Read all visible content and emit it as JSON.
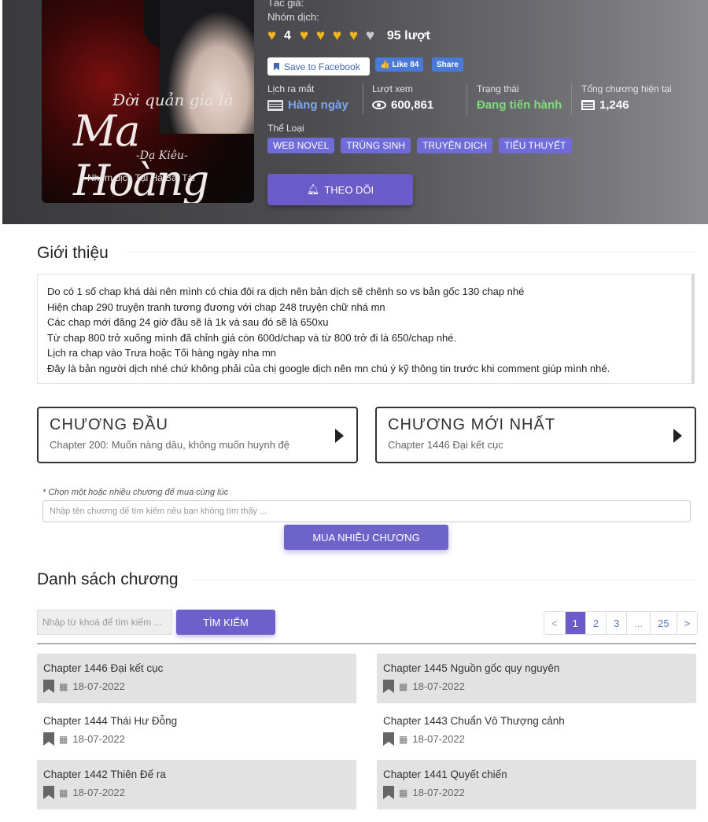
{
  "cover": {
    "title_line1": "Đời quản gia là",
    "title_main": "Ma Hoàng",
    "author_mark": "-Dạ Kiêu-",
    "group": "Nhóm dịch Tại Hạ Bất Tài"
  },
  "info": {
    "author_label": "Tác giả:",
    "translator_label": "Nhóm dịch:",
    "rating_value": "4",
    "rating_count": "95 lượt",
    "fb_save": "Save to Facebook",
    "fb_like": "Like 84",
    "fb_share": "Share"
  },
  "stats": [
    {
      "label": "Lịch ra mắt",
      "value": "Hàng ngày",
      "icon": "newspaper-icon"
    },
    {
      "label": "Lượt xem",
      "value": "600,861",
      "icon": "eye-icon"
    },
    {
      "label": "Trạng thái",
      "value": "Đang tiến hành",
      "icon": ""
    },
    {
      "label": "Tổng chương hiện tại",
      "value": "1,246",
      "icon": "list-icon"
    }
  ],
  "genre_label": "Thể Loại",
  "tags": [
    "WEB NOVEL",
    "TRÙNG SINH",
    "TRUYỆN DỊCH",
    "TIỂU THUYẾT"
  ],
  "follow_label": "THEO DÕI",
  "intro": {
    "title": "Giới thiệu",
    "lines": [
      "Do có 1 số chap khá dài nên mình có chia đôi ra dịch nên bản dịch sẽ chênh so vs bản gốc 130 chap nhé",
      "Hiện chap 290 truyện tranh tương đương với chap 248 truyện chữ nhá mn",
      "Các chap mới đăng 24 giờ đầu sẽ là 1k và sau đó sẽ là 650xu",
      "Từ  chap 800 trở xuống mình đã chỉnh giá còn 600d/chap và từ 800 trở đi là 650/chap nhé.",
      "Lịch ra chap vào Trưa hoặc Tối hàng ngày nha mn",
      "Đây là bản người dịch nhé chứ không phải của chị google dịch nên mn chú ý kỹ thông tin trước khi comment giúp mình nhé."
    ]
  },
  "first_chapter": {
    "heading": "CHƯƠNG ĐẦU",
    "sub": "Chapter 200: Muốn nàng dâu, không muốn huynh đệ"
  },
  "latest_chapter": {
    "heading": "CHƯƠNG MỚI NHẤT",
    "sub": "Chapter 1446 Đại kết cục"
  },
  "multi": {
    "hint": "* Chọn một hoặc nhiều chương để mua cùng lúc",
    "placeholder": "Nhập tên chương để tìm kiếm nếu bạn không tìm thấy ...",
    "button": "MUA NHIỀU CHƯƠNG"
  },
  "chapter_list": {
    "title": "Danh sách chương",
    "search_placeholder": "Nhập từ khoá để tìm kiếm ...",
    "search_button": "TÌM KIẾM",
    "pages": [
      "<",
      "1",
      "2",
      "3",
      "...",
      "25",
      ">"
    ],
    "items": [
      {
        "name": "Chapter 1446 Đại kết cục",
        "date": "18-07-2022"
      },
      {
        "name": "Chapter 1445 Nguồn gốc quy nguyên",
        "date": "18-07-2022"
      },
      {
        "name": "Chapter 1444 Thái Hư Đỗng",
        "date": "18-07-2022"
      },
      {
        "name": "Chapter 1443 Chuẩn Vô Thượng cảnh",
        "date": "18-07-2022"
      },
      {
        "name": "Chapter 1442 Thiên Đế ra",
        "date": "18-07-2022"
      },
      {
        "name": "Chapter 1441 Quyết chiến",
        "date": "18-07-2022"
      }
    ]
  }
}
